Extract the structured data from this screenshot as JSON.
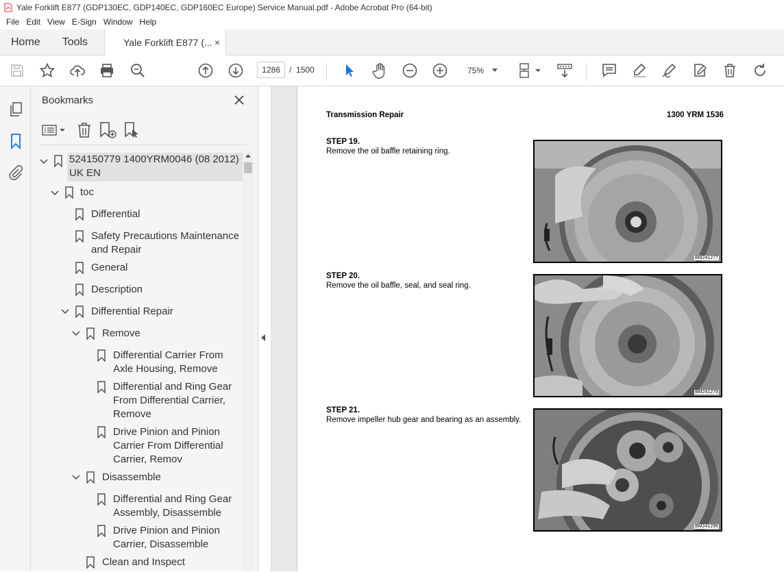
{
  "window": {
    "title": "Yale Forklift E877 (GDP130EC, GDP140EC, GDP160EC Europe) Service Manual.pdf - Adobe Acrobat Pro (64-bit)"
  },
  "menu": [
    "File",
    "Edit",
    "View",
    "E-Sign",
    "Window",
    "Help"
  ],
  "tabs": {
    "home": "Home",
    "tools": "Tools",
    "document": "Yale Forklift E877 (...",
    "close_glyph": "×"
  },
  "toolbar": {
    "page_current": "1286",
    "page_separator": "/",
    "page_total": "1500",
    "zoom": "75%"
  },
  "bookmarks": {
    "title": "Bookmarks",
    "items": [
      {
        "label_line1": "524150779 1400YRM0046 (08 2012)",
        "label_line2": "UK EN",
        "expanded": true,
        "selected": true
      },
      {
        "label_line1": "toc",
        "expanded": true
      },
      {
        "label_line1": "Differential"
      },
      {
        "label_line1": "Safety Precautions Maintenance",
        "label_line2": "and Repair"
      },
      {
        "label_line1": "General"
      },
      {
        "label_line1": "Description"
      },
      {
        "label_line1": "Differential Repair",
        "expanded": true
      },
      {
        "label_line1": "Remove",
        "expanded": true
      },
      {
        "label_line1": "Differential Carrier From",
        "label_line2": "Axle Housing, Remove"
      },
      {
        "label_line1": "Differential and Ring Gear",
        "label_line2": "From Differential Carrier,",
        "label_line3": "Remove"
      },
      {
        "label_line1": "Drive Pinion and Pinion",
        "label_line2": "Carrier From Differential",
        "label_line3": "Carrier, Remov"
      },
      {
        "label_line1": "Disassemble",
        "expanded": true
      },
      {
        "label_line1": "Differential and Ring Gear",
        "label_line2": "Assembly, Disassemble"
      },
      {
        "label_line1": "Drive Pinion and Pinion",
        "label_line2": "Carrier, Disassemble"
      },
      {
        "label_line1": "Clean and Inspect"
      }
    ]
  },
  "document": {
    "header_left": "Transmission Repair",
    "header_right": "1300 YRM 1536",
    "steps": [
      {
        "title": "STEP 19.",
        "text": "Remove the oil baffle retaining ring.",
        "photo_tag": "BM241277"
      },
      {
        "title": "STEP 20.",
        "text": "Remove the oil baffle, seal, and seal ring.",
        "photo_tag": "BM241278"
      },
      {
        "title": "STEP 21.",
        "text": "Remove impeller hub gear and bearing as an assembly.",
        "photo_tag": "BM241296"
      }
    ]
  },
  "colors": {
    "accent_blue": "#1473e6",
    "acrobat_red": "#d7373f"
  }
}
